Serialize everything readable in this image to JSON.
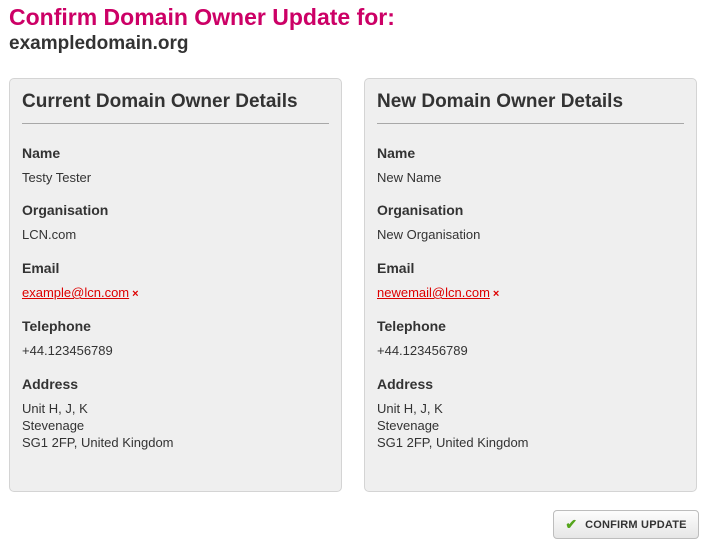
{
  "header": {
    "title": "Confirm Domain Owner Update for:",
    "domain": "exampledomain.org"
  },
  "current": {
    "heading": "Current Domain Owner Details",
    "name_label": "Name",
    "name": "Testy Tester",
    "org_label": "Organisation",
    "org": "LCN.com",
    "email_label": "Email",
    "email": "example@lcn.com",
    "tel_label": "Telephone",
    "tel": "+44.123456789",
    "addr_label": "Address",
    "addr_line1": "Unit H, J, K",
    "addr_line2": "Stevenage",
    "addr_line3": "SG1 2FP, United Kingdom"
  },
  "new": {
    "heading": "New Domain Owner Details",
    "name_label": "Name",
    "name": "New Name",
    "org_label": "Organisation",
    "org": "New Organisation",
    "email_label": "Email",
    "email": "newemail@lcn.com",
    "tel_label": "Telephone",
    "tel": "+44.123456789",
    "addr_label": "Address",
    "addr_line1": "Unit H, J, K",
    "addr_line2": "Stevenage",
    "addr_line3": "SG1 2FP, United Kingdom"
  },
  "icons": {
    "remove": "×",
    "check": "✔"
  },
  "actions": {
    "confirm_label": "CONFIRM UPDATE"
  },
  "colors": {
    "title": "#cc0066",
    "email_link": "#dd0000",
    "check": "#55a51c"
  }
}
